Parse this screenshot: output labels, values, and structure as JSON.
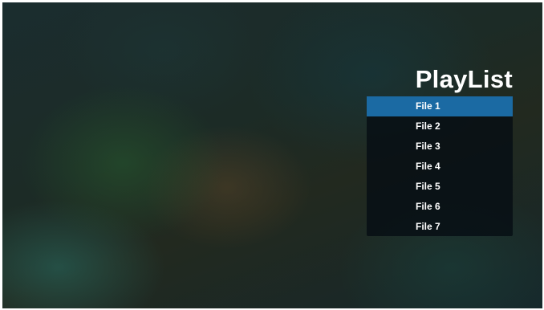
{
  "playlist": {
    "title": "PlayList",
    "selected_index": 0,
    "selected_color": "#1b6aa3",
    "items": [
      {
        "label": "File 1"
      },
      {
        "label": "File 2"
      },
      {
        "label": "File 3"
      },
      {
        "label": "File 4"
      },
      {
        "label": "File 5"
      },
      {
        "label": "File 6"
      },
      {
        "label": "File 7"
      }
    ]
  }
}
